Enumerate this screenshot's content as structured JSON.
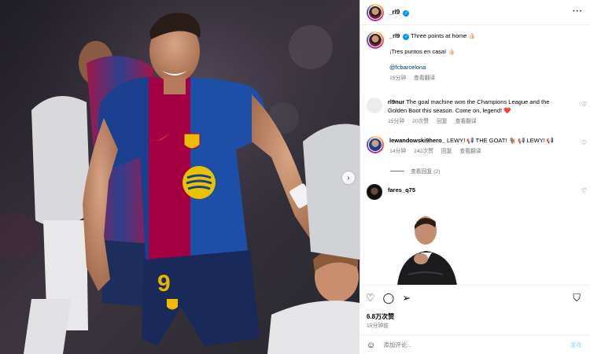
{
  "post": {
    "username": "_rl9",
    "more_icon": "more-horizontal-icon"
  },
  "caption": {
    "username": "_rl9",
    "line1": "Three points at home",
    "line1_emoji": "👍🏻",
    "line2": "¡Tres puntos en casa!",
    "line2_emoji": "👍🏻",
    "mention": "@fcbarcelona",
    "time": "15分钟",
    "translate": "查看翻译"
  },
  "comments": [
    {
      "username": "rl9nur",
      "text": "The goal machine won the Champions League and the Golden Boot this season. Come on, legend!",
      "emoji": "❤️",
      "time": "15分钟",
      "likes": "20次赞",
      "reply": "回复",
      "translate": "查看翻译"
    },
    {
      "username": "lewandowski9hero_",
      "text": "LEWY! 📢 THE GOAT! 🐐 📢 LEWY! 📢",
      "time": "14分钟",
      "likes": "242次赞",
      "reply": "回复",
      "translate": "查看翻译",
      "view_replies": "查看回复 (2)"
    },
    {
      "username": "fares_q75",
      "text": ""
    }
  ],
  "footer": {
    "views": "6.8万次赞",
    "ago": "15分钟前",
    "comment_placeholder": "添加评论...",
    "post_label": "发布"
  },
  "colors": {
    "verified": "#0095f6",
    "link": "#00376b",
    "barca_blue": "#1b3f8f",
    "barca_red": "#a50044"
  }
}
